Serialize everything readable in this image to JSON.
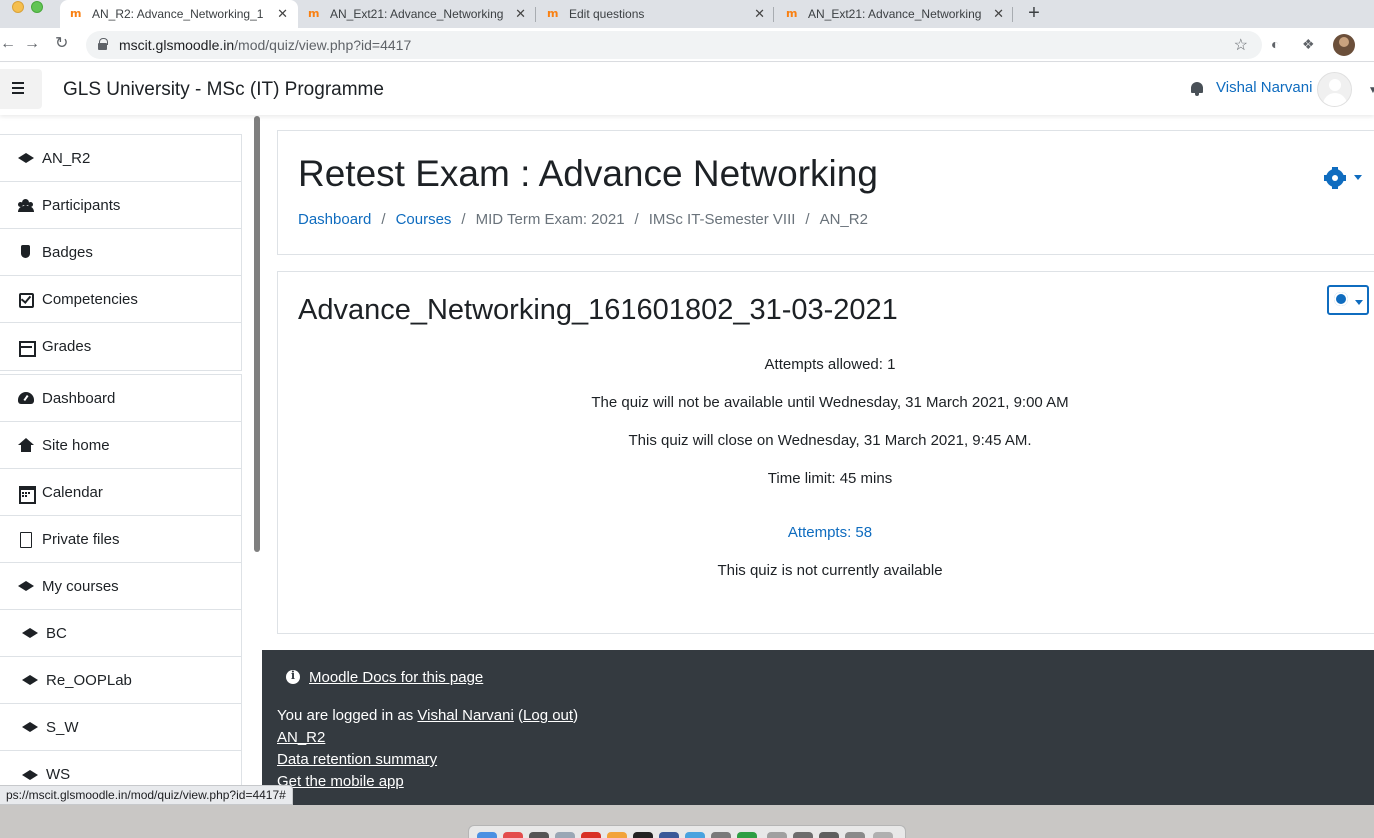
{
  "browser": {
    "tabs": [
      {
        "title": "AN_R2: Advance_Networking_1",
        "close": "✕",
        "active": true
      },
      {
        "title": "AN_Ext21: Advance_Networking",
        "close": "✕",
        "active": false
      },
      {
        "title": "Edit questions",
        "close": "✕",
        "active": false
      },
      {
        "title": "AN_Ext21: Advance_Networking",
        "close": "✕",
        "active": false
      }
    ],
    "favicon": "m",
    "new_tab": "+",
    "url_host": "mscit.glsmoodle.in",
    "url_path": "/mod/quiz/view.php?id=4417"
  },
  "navbar": {
    "site_name": "GLS University - MSc (IT) Programme",
    "user_name": "Vishal Narvani"
  },
  "sidebar": {
    "course_items": [
      {
        "label": "AN_R2",
        "icon": "graduation-cap-icon"
      },
      {
        "label": "Participants",
        "icon": "users-icon"
      },
      {
        "label": "Badges",
        "icon": "shield-icon"
      },
      {
        "label": "Competencies",
        "icon": "check-square-icon"
      },
      {
        "label": "Grades",
        "icon": "table-icon"
      }
    ],
    "site_items": [
      {
        "label": "Dashboard",
        "icon": "tachometer-icon"
      },
      {
        "label": "Site home",
        "icon": "home-icon"
      },
      {
        "label": "Calendar",
        "icon": "calendar-icon"
      },
      {
        "label": "Private files",
        "icon": "file-icon"
      },
      {
        "label": "My courses",
        "icon": "graduation-cap-icon"
      },
      {
        "label": "BC",
        "icon": "graduation-cap-icon"
      },
      {
        "label": "Re_OOPLab",
        "icon": "graduation-cap-icon"
      },
      {
        "label": "S_W",
        "icon": "graduation-cap-icon"
      },
      {
        "label": "WS",
        "icon": "graduation-cap-icon"
      }
    ]
  },
  "header": {
    "title": "Retest Exam : Advance Networking",
    "breadcrumb": [
      {
        "label": "Dashboard",
        "link": true
      },
      {
        "label": "Courses",
        "link": true
      },
      {
        "label": "MID Term Exam: 2021",
        "link": false
      },
      {
        "label": "IMSc IT-Semester VIII",
        "link": false
      },
      {
        "label": "AN_R2",
        "link": false
      }
    ],
    "separator": "/"
  },
  "quiz": {
    "name": "Advance_Networking_161601802_31-03-2021",
    "attempts_allowed": "Attempts allowed: 1",
    "open_notice": "The quiz will not be available until Wednesday, 31 March 2021, 9:00 AM",
    "close_notice": "This quiz will close on Wednesday, 31 March 2021, 9:45 AM.",
    "time_limit": "Time limit: 45 mins",
    "attempts_link": "Attempts: 58",
    "availability": "This quiz is not currently available"
  },
  "footer": {
    "docs_link": "Moodle Docs for this page",
    "logged_in_prefix": "You are logged in as ",
    "logged_in_user": "Vishal Narvani",
    "open_paren": " (",
    "logout": "Log out",
    "close_paren": ")",
    "course_link": "AN_R2",
    "data_retention": "Data retention summary",
    "mobile_app": "Get the mobile app"
  },
  "status_bar": {
    "hover_url": "ps://mscit.glsmoodle.in/mod/quiz/view.php?id=4417#"
  },
  "colors": {
    "accent": "#0f6cbf",
    "footer_bg": "#343a40",
    "text": "#1d2125",
    "muted": "#6a737b"
  }
}
